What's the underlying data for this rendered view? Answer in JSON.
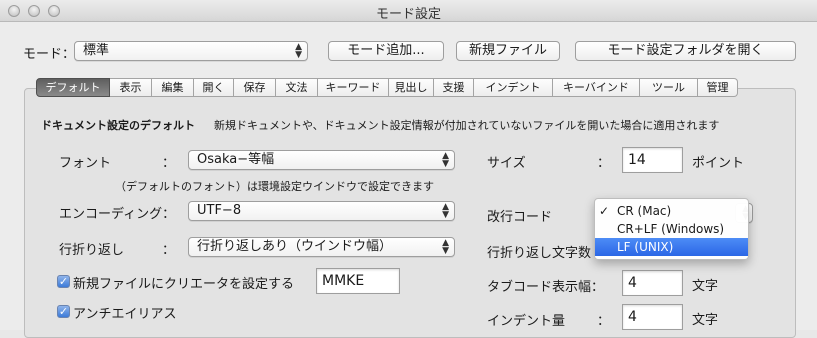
{
  "window": {
    "title": "モード設定"
  },
  "toolbar": {
    "mode_label": "モード：",
    "mode_value": "標準",
    "add_mode": "モード追加...",
    "new_file": "新規ファイル",
    "open_folder": "モード設定フォルダを開く"
  },
  "tabs": [
    "デフォルト",
    "表示",
    "編集",
    "開く",
    "保存",
    "文法",
    "キーワード",
    "見出し",
    "支援",
    "インデント",
    "キーバインド",
    "ツール",
    "管理"
  ],
  "panel": {
    "section_title": "ドキュメント設定のデフォルト",
    "section_desc": "新規ドキュメントや、ドキュメント設定情報が付加されていないファイルを開いた場合に適用されます",
    "font_label": "フォント",
    "font_value": "Osaka−等幅",
    "font_note": "（デフォルトのフォント）は環境設定ウインドウで設定できます",
    "encoding_label": "エンコーディング：",
    "encoding_value": "UTF−8",
    "wrap_label": "行折り返し",
    "wrap_value": "行折り返しあり（ウインドウ幅）",
    "creator_label": "新規ファイルにクリエータを設定する",
    "creator_value": "MMKE",
    "antialias_label": "アンチエイリアス",
    "size_label": "サイズ",
    "size_value": "14",
    "size_unit": "ポイント",
    "linebreak_label": "改行コード",
    "wrapchars_label": "行折り返し文字数",
    "tabwidth_label": "タブコード表示幅：",
    "tabwidth_value": "4",
    "tabwidth_unit": "文字",
    "indent_label": "インデント量",
    "indent_value": "4",
    "indent_unit": "文字",
    "colon": "："
  },
  "linebreak_menu": {
    "items": [
      "CR (Mac)",
      "CR+LF (Windows)",
      "LF (UNIX)"
    ],
    "checked": "✓",
    "highlight_color": "#2b67e6"
  },
  "icons": {
    "popup_arrows": "⌃⌄",
    "checkbox_check": "✓"
  }
}
